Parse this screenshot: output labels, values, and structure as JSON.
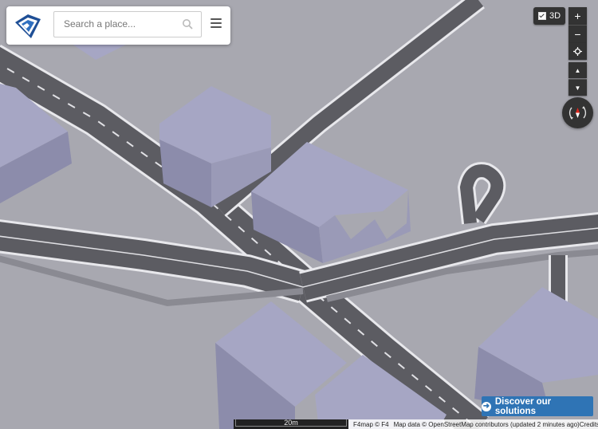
{
  "search": {
    "placeholder": "Search a place..."
  },
  "toolbar": {
    "btn3d_label": "3D",
    "zoom_in": "+",
    "zoom_out": "−",
    "tilt_up": "▲",
    "tilt_down": "▼"
  },
  "promo": {
    "discover_label": "Discover our solutions"
  },
  "scale": {
    "label": "20m"
  },
  "attribution": {
    "f4map": "F4map © F4",
    "mapdata": "Map data © OpenStreetMap contributors (updated 2 minutes ago)",
    "credits": "Credits"
  },
  "colors": {
    "ground": "#a8a8b0",
    "road": "#5a5a5f",
    "building_top": "#a6a6c4",
    "building_side": "#8c8cab",
    "accent": "#2f74b5"
  },
  "icons": [
    "f4map-logo-icon",
    "search-icon",
    "menu-icon",
    "checkbox-icon",
    "plus-icon",
    "minus-icon",
    "locate-icon",
    "chevron-up-icon",
    "chevron-down-icon",
    "compass-icon",
    "arrow-right-circle-icon"
  ]
}
